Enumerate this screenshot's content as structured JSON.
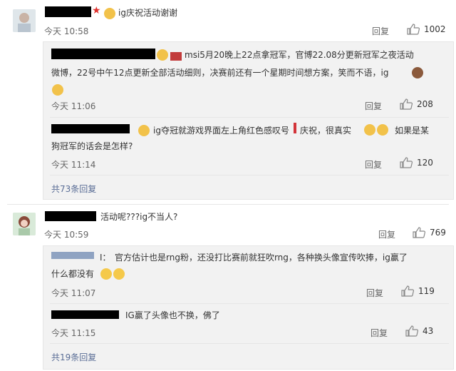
{
  "comments": [
    {
      "text": "ig庆祝活动谢谢",
      "time": "今天 10:58",
      "reply_label": "回复",
      "like_count": "1002",
      "replies": [
        {
          "line1": "msi5月20晚上22点拿冠军，官博22.08分更新冠军之夜活动",
          "line2": "微博，22号中午12点更新全部活动细则，决赛前还有一个星期时间想方案，笑而不语，ig",
          "time": "今天 11:06",
          "reply_label": "回复",
          "like_count": "208"
        },
        {
          "line1": "ig夺冠就游戏界面左上角红色感叹号",
          "line1b": "庆祝，很真实",
          "line1c": "如果是某",
          "line2": "狗冠军的话会是怎样?",
          "time": "今天 11:14",
          "reply_label": "回复",
          "like_count": "120"
        }
      ],
      "more_label": "共73条回复"
    },
    {
      "text": "活动呢???ig不当人?",
      "time": "今天 10:59",
      "reply_label": "回复",
      "like_count": "769",
      "replies": [
        {
          "prefix": "I：",
          "line1": "官方估计也是rng粉，还没打比赛前就狂吹rng，各种换头像宣传吹捧，ig赢了",
          "line2": "什么都没有",
          "time": "今天 11:07",
          "reply_label": "回复",
          "like_count": "119"
        },
        {
          "line1": "IG赢了头像也不换，佛了",
          "time": "今天 11:15",
          "reply_label": "回复",
          "like_count": "43"
        }
      ],
      "more_label": "共19条回复"
    }
  ],
  "icons": [
    "star-icon",
    "emoji-icon",
    "thumbs-up-icon"
  ]
}
